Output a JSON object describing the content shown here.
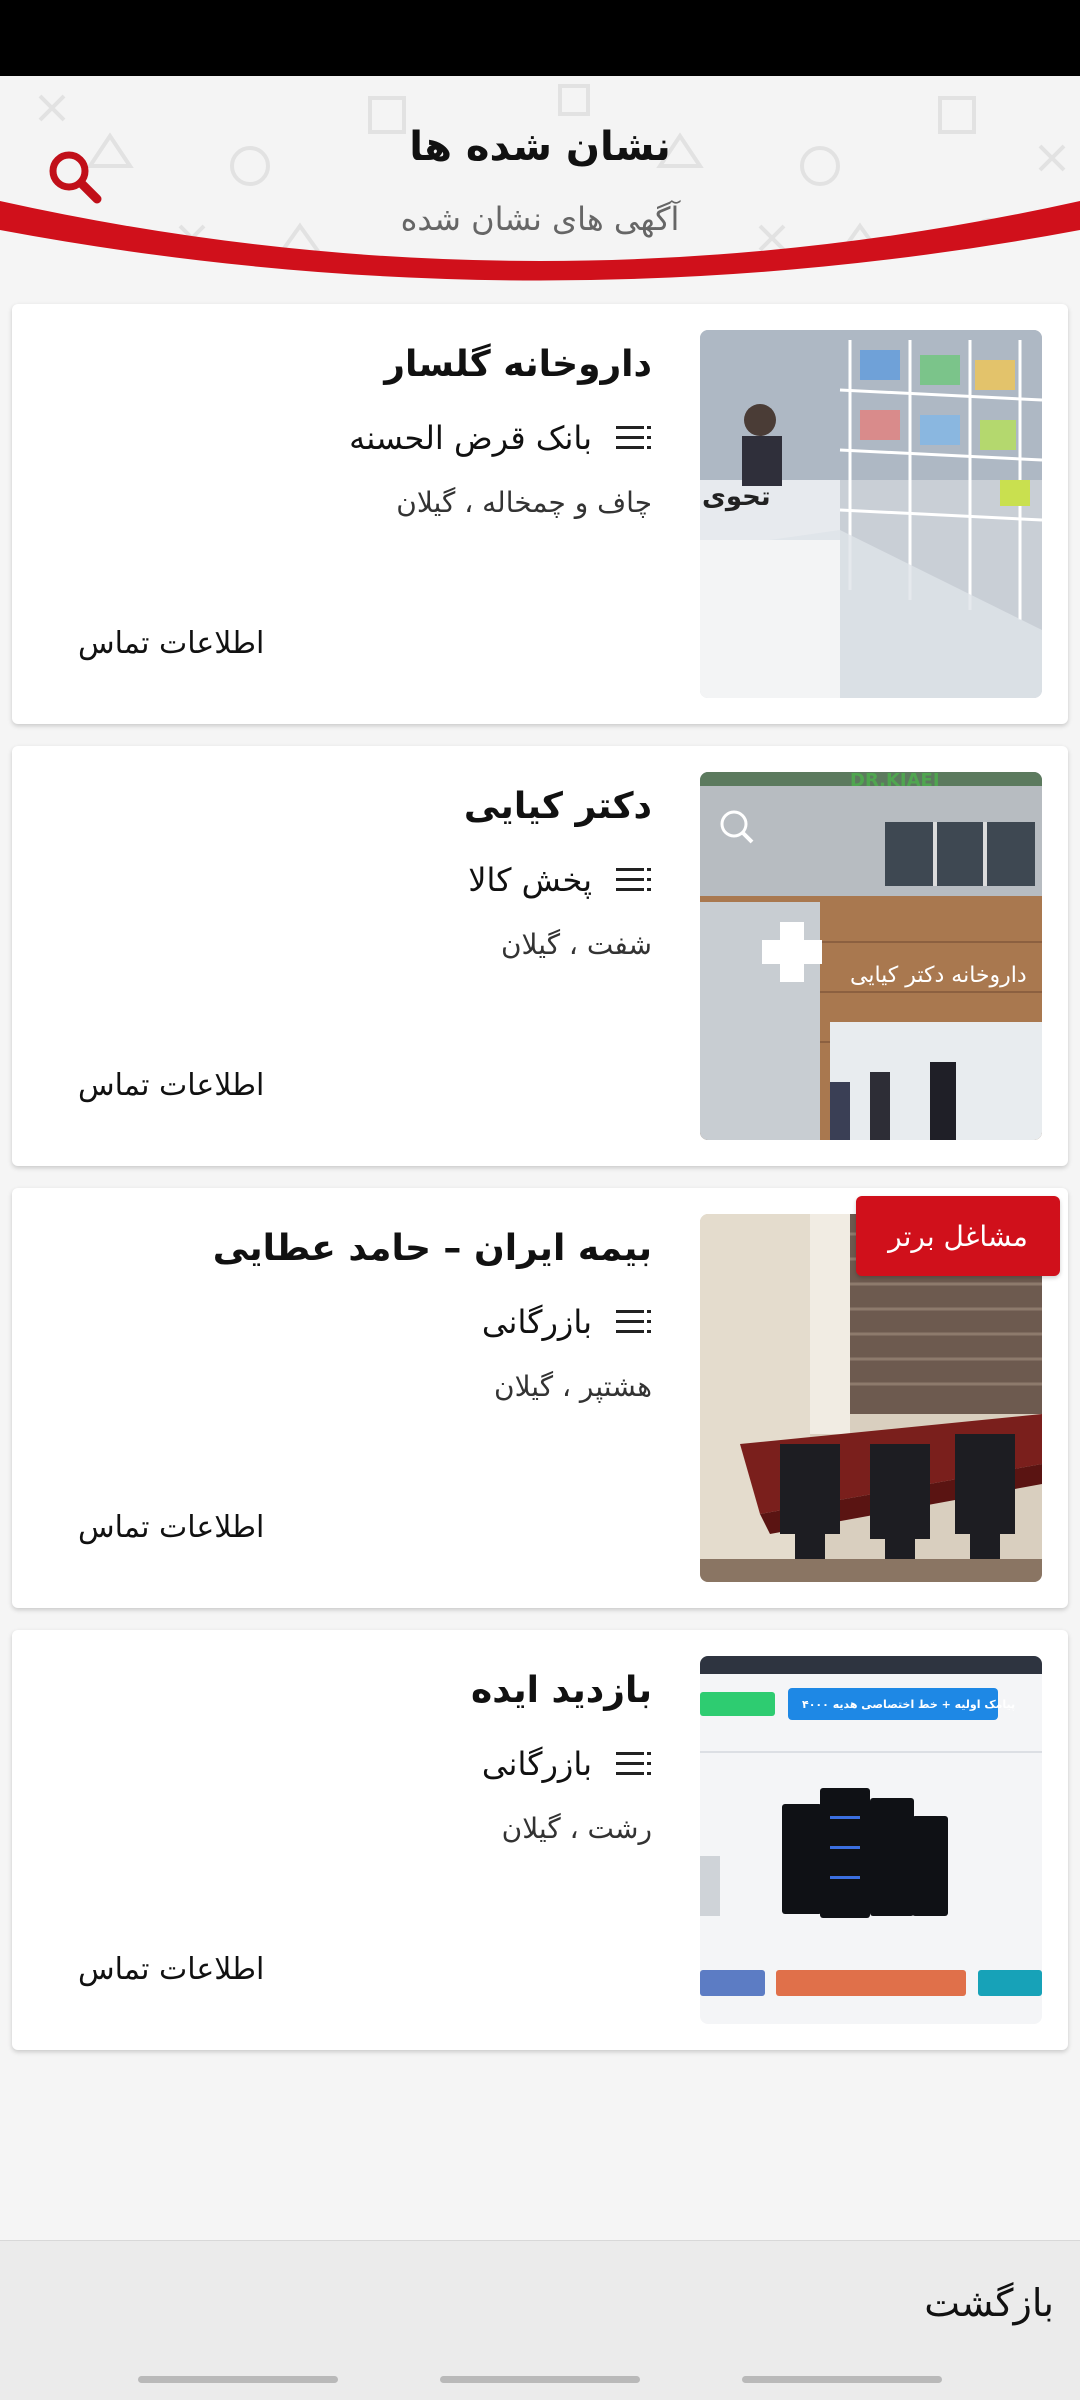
{
  "header": {
    "title": "نشان شده ها",
    "subtitle": "آگهی های نشان شده",
    "search_icon": "search-icon",
    "accent_color": "#d0101b"
  },
  "listings": [
    {
      "title": "داروخانه گلسار",
      "category": "بانک قرض الحسنه",
      "location": "چاف و چمخاله ، گیلان",
      "contact_label": "اطلاعات تماس",
      "image": "pharmacy-interior-photo"
    },
    {
      "title": "دکتر کیایی",
      "category": "پخش کالا",
      "location": "شفت ، گیلان",
      "contact_label": "اطلاعات تماس",
      "image": "pharmacy-storefront-photo",
      "storefront_sign": "DR.KIAEI"
    },
    {
      "title": "بیمه ایران – حامد عطایی",
      "category": "بازرگانی",
      "location": "هشتپر ، گیلان",
      "contact_label": "اطلاعات تماس",
      "image": "office-meeting-room-photo",
      "badge": "مشاغل برتر"
    },
    {
      "title": "بازدید ایده",
      "category": "بازرگانی",
      "location": "رشت ، گیلان",
      "contact_label": "اطلاعات تماس",
      "image": "web-hosting-servers-screenshot",
      "banner": "۴۰۰۰ پیامک اولیه + خط اختصاصی هدیه"
    }
  ],
  "bottom_bar": {
    "back_label": "بازگشت"
  },
  "category_icon": "list-icon"
}
